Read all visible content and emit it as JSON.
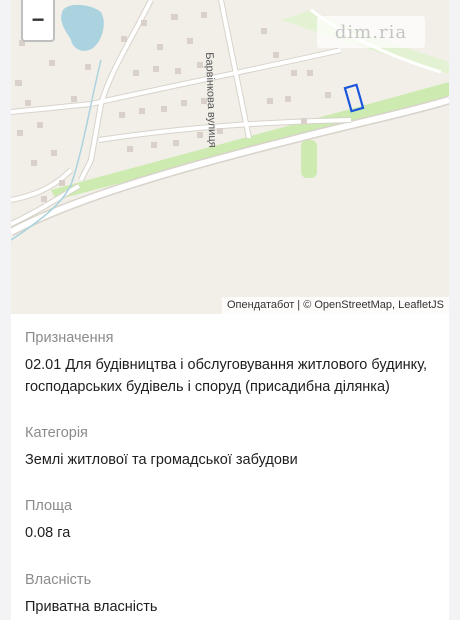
{
  "map": {
    "zoom_out_label": "−",
    "watermark_text": "dim.ria",
    "street_label": "Барвінкова вулиця",
    "attribution": "Опендатабот | © OpenStreetMap, LeafletJS",
    "colors": {
      "land": "#f2efe9",
      "road": "#ffffff",
      "road_casing": "#d8d3cb",
      "park": "#cdebb0",
      "water": "#aad3df",
      "building": "#d9d0c9",
      "parcel_outline": "#1a56db"
    }
  },
  "details": {
    "purpose": {
      "label": "Призначення",
      "value": "02.01 Для будівництва і обслуговування житлового будинку, господарських будівель і споруд (присадибна ділянка)"
    },
    "category": {
      "label": "Категорія",
      "value": "Землі житлової та громадської забудови"
    },
    "area": {
      "label": "Площа",
      "value": "0.08 га"
    },
    "ownership": {
      "label": "Власність",
      "value": "Приватна власність"
    }
  }
}
